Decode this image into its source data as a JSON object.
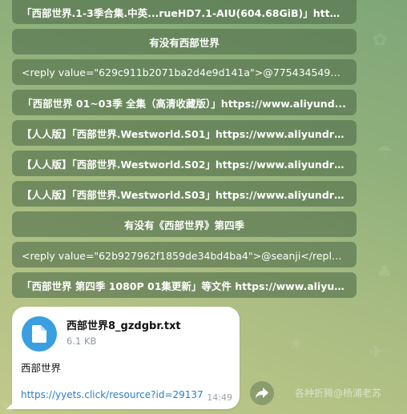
{
  "buttons": [
    {
      "label": "「西部世界.1-3季合集.中英...rueHD7.1-AIU(604.68GiB)」https://..."
    },
    {
      "label": "有没有西部世界"
    },
    {
      "label": "<reply value=\"629c911b2071ba2d4e9d141a\">@775434549</reply..."
    },
    {
      "label": "「西部世界 01~03季 全集（高清收藏版）」https://www.aliyund..."
    },
    {
      "label": "【人人版】「西部世界.Westworld.S01」https://www.aliyundriv..."
    },
    {
      "label": "【人人版】「西部世界.Westworld.S02」https://www.aliyundriv..."
    },
    {
      "label": "【人人版】「西部世界.Westworld.S03」https://www.aliyundriv..."
    },
    {
      "label": "有没有《西部世界》第四季"
    },
    {
      "label": "<reply value=\"62b927962f1859de34bd4ba4\">@seanji</reply>「..."
    },
    {
      "label": "「西部世界 第四季 1080P 01集更新」等文件 https://www.aliyun..."
    }
  ],
  "message": {
    "file_name": "西部世界8_gzdgbr.txt",
    "file_size": "6.1 KB",
    "caption": "西部世界",
    "link": "https://yyets.click/resource?id=29137",
    "time": "14:49"
  },
  "watermark": "各种折腾@杨浦老苏",
  "icons": {
    "file": "file-icon",
    "forward": "forward-icon"
  },
  "colors": {
    "button_bg": "#5a7a52",
    "file_icon_bg": "#3a9fe0",
    "link": "#2a7fc2"
  }
}
